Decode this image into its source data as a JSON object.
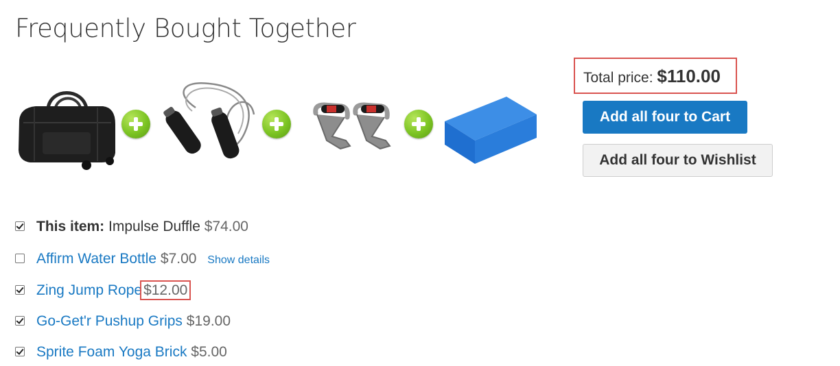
{
  "section_title": "Frequently Bought Together",
  "products": [
    {
      "name": "Impulse Duffle",
      "icon": "duffle-bag-image"
    },
    {
      "name": "Zing Jump Rope",
      "icon": "jump-rope-image"
    },
    {
      "name": "Go-Get'r Pushup Grips",
      "icon": "pushup-grips-image"
    },
    {
      "name": "Sprite Foam Yoga Brick",
      "icon": "yoga-brick-image"
    }
  ],
  "plus_icon": "plus-icon",
  "total": {
    "label": "Total price:",
    "amount": "$110.00"
  },
  "buttons": {
    "add_to_cart": "Add all four to Cart",
    "add_to_wishlist": "Add all four to Wishlist"
  },
  "items": [
    {
      "prefix": "This item:",
      "name": "Impulse Duffle",
      "price": "$74.00",
      "checked": true
    },
    {
      "name": "Affirm Water Bottle",
      "price": "$7.00",
      "checked": false,
      "extra": "Show details"
    },
    {
      "name": "Zing Jump Rope",
      "price": "$12.00",
      "checked": true
    },
    {
      "name": "Go-Get'r Pushup Grips",
      "price": "$19.00",
      "checked": true
    },
    {
      "name": "Sprite Foam Yoga Brick",
      "price": "$5.00",
      "checked": true
    }
  ],
  "colors": {
    "link": "#1979c3",
    "highlight": "#d9534f",
    "plus": "#7cc423",
    "primary_button": "#1979c3"
  }
}
